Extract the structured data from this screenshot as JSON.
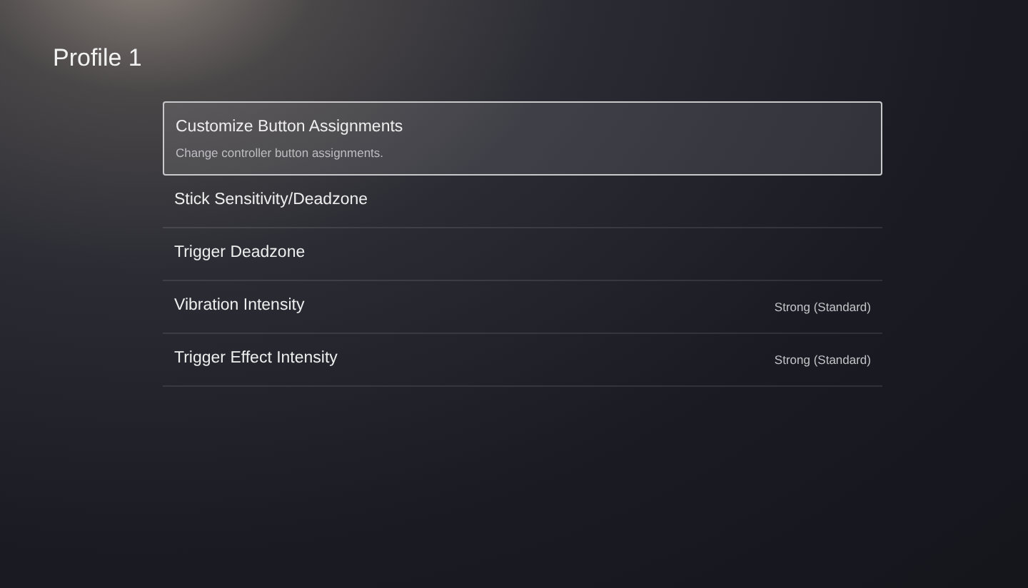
{
  "title": "Profile 1",
  "items": [
    {
      "label": "Customize Button Assignments",
      "description": "Change controller button assignments.",
      "selected": true
    },
    {
      "label": "Stick Sensitivity/Deadzone",
      "selected": false
    },
    {
      "label": "Trigger Deadzone",
      "selected": false
    },
    {
      "label": "Vibration Intensity",
      "value": "Strong (Standard)",
      "selected": false
    },
    {
      "label": "Trigger Effect Intensity",
      "value": "Strong (Standard)",
      "selected": false
    }
  ]
}
